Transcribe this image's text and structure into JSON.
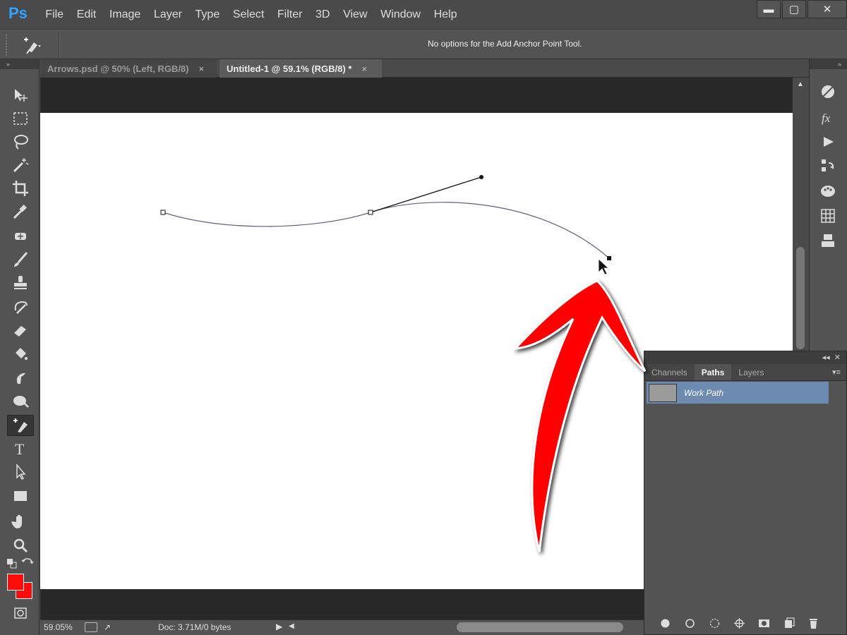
{
  "app": {
    "logo": "Ps"
  },
  "menu": [
    "File",
    "Edit",
    "Image",
    "Layer",
    "Type",
    "Select",
    "Filter",
    "3D",
    "View",
    "Window",
    "Help"
  ],
  "window_controls": {
    "minimize": "▬",
    "restore": "▢",
    "close": "✕"
  },
  "options_bar": {
    "message": "No options for the Add Anchor Point Tool."
  },
  "tabs": [
    {
      "label": "Arrows.psd @ 50% (Left, RGB/8)",
      "close": "×",
      "active": false
    },
    {
      "label": "Untitled-1 @ 59.1% (RGB/8) *",
      "close": "×",
      "active": true
    }
  ],
  "tools": [
    "move-tool",
    "marquee-tool",
    "lasso-tool",
    "magic-wand-tool",
    "crop-tool",
    "eyedropper-tool",
    "spot-healing-tool",
    "brush-tool",
    "clone-stamp-tool",
    "history-brush-tool",
    "eraser-tool",
    "paint-bucket-tool",
    "blur-tool",
    "dodge-tool",
    "add-anchor-point-tool",
    "type-tool",
    "path-selection-tool",
    "rectangle-tool",
    "hand-tool",
    "zoom-tool"
  ],
  "active_tool": "add-anchor-point-tool",
  "colors": {
    "foreground": "#ff0b0b",
    "background": "#ff0b0b",
    "highlight_arrow": "#ff0000",
    "selection_row": "#6d8bb0"
  },
  "status": {
    "zoom": "59.05%",
    "doc": "Doc: 3.71M/0 bytes"
  },
  "dock_icons": [
    "adjustments-icon",
    "styles-fx-icon",
    "actions-play-icon",
    "history-icon",
    "swatches-icon",
    "grid-icon",
    "libraries-icon"
  ],
  "panel": {
    "tabs": [
      "Channels",
      "Paths",
      "Layers"
    ],
    "active_tab": "Paths",
    "paths": [
      {
        "name": "Work Path"
      }
    ],
    "footer_icons": [
      "fill-path-icon",
      "stroke-path-icon",
      "load-selection-icon",
      "make-work-path-icon",
      "add-mask-icon",
      "new-path-icon",
      "delete-path-icon"
    ]
  }
}
